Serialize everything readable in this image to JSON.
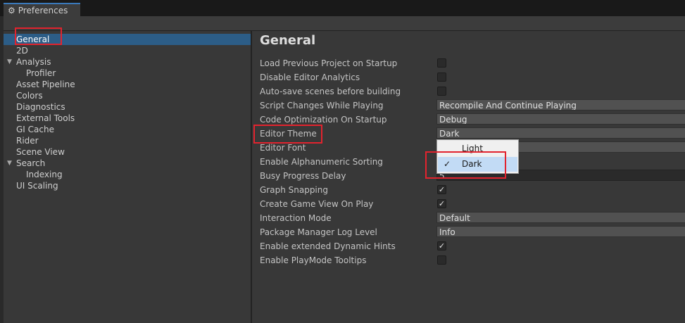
{
  "window": {
    "tab_title": "Preferences",
    "tab_icon": "gear-icon"
  },
  "sidebar": {
    "items": [
      {
        "label": "General",
        "selected": true
      },
      {
        "label": "2D"
      },
      {
        "label": "Analysis",
        "expanded": true
      },
      {
        "label": "Profiler",
        "child": true
      },
      {
        "label": "Asset Pipeline"
      },
      {
        "label": "Colors"
      },
      {
        "label": "Diagnostics"
      },
      {
        "label": "External Tools"
      },
      {
        "label": "GI Cache"
      },
      {
        "label": "Rider"
      },
      {
        "label": "Scene View"
      },
      {
        "label": "Search",
        "expanded": true
      },
      {
        "label": "Indexing",
        "child": true
      },
      {
        "label": "UI Scaling"
      }
    ]
  },
  "main": {
    "title": "General",
    "rows": [
      {
        "label": "Load Previous Project on Startup",
        "control": "checkbox",
        "checked": false
      },
      {
        "label": "Disable Editor Analytics",
        "control": "checkbox",
        "checked": false
      },
      {
        "label": "Auto-save scenes before building",
        "control": "checkbox",
        "checked": false
      },
      {
        "label": "Script Changes While Playing",
        "control": "dropdown",
        "value": "Recompile And Continue Playing"
      },
      {
        "label": "Code Optimization On Startup",
        "control": "dropdown",
        "value": "Debug"
      },
      {
        "label": "Editor Theme",
        "control": "dropdown",
        "value": "Dark"
      },
      {
        "label": "Editor Font",
        "control": "dropdown",
        "value": ""
      },
      {
        "label": "Enable Alphanumeric Sorting",
        "control": "checkbox",
        "checked": false
      },
      {
        "label": "Busy Progress Delay",
        "control": "number",
        "value": "5"
      },
      {
        "label": "Graph Snapping",
        "control": "checkbox",
        "checked": true
      },
      {
        "label": "Create Game View On Play",
        "control": "checkbox",
        "checked": true
      },
      {
        "label": "Interaction Mode",
        "control": "dropdown",
        "value": "Default"
      },
      {
        "label": "Package Manager Log Level",
        "control": "dropdown",
        "value": "Info"
      },
      {
        "label": "Enable extended Dynamic Hints",
        "control": "checkbox",
        "checked": true
      },
      {
        "label": "Enable PlayMode Tooltips",
        "control": "checkbox",
        "checked": false
      }
    ]
  },
  "theme_popup": {
    "options": [
      {
        "label": "Light",
        "checked": false
      },
      {
        "label": "Dark",
        "checked": true
      }
    ]
  },
  "colors": {
    "selection": "#2c5d87",
    "highlight_box": "#e2232e",
    "tab_accent": "#3a79bb"
  }
}
